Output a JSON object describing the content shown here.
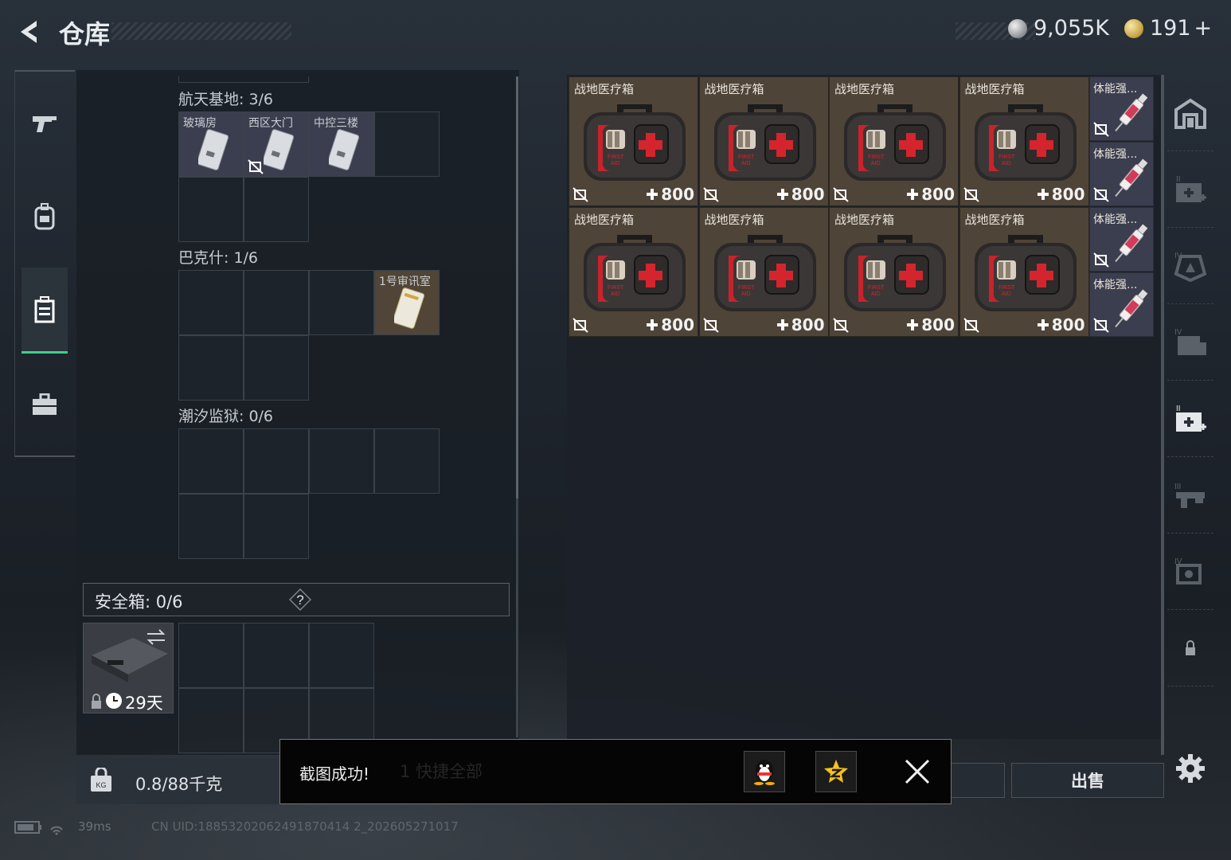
{
  "header": {
    "title": "仓库",
    "silver_amount": "9,055K",
    "gold_amount": "191",
    "gold_plus": "+"
  },
  "left": {
    "sections": [
      {
        "label": "航天基地: 3/6"
      },
      {
        "label": "巴克什: 1/6"
      },
      {
        "label": "潮汐监狱: 0/6"
      }
    ],
    "keycards": {
      "k1": "玻璃房",
      "k2": "西区大门",
      "k3": "中控三楼",
      "k4": "1号审讯室"
    },
    "safe_label": "安全箱:  0/6",
    "safe_help": "?",
    "safe_days": "29天",
    "weight": "0.8/88千克"
  },
  "items": {
    "medkit_name": "战地医疗箱",
    "medkit_value": "800",
    "syringe_name": "体能强..."
  },
  "toast": {
    "message": "截图成功!",
    "ghost_text": "1    快捷全部"
  },
  "actions": {
    "sell": "出售"
  },
  "status": {
    "ping": "39ms",
    "uid": "CN UID:18853202062491870414 2_202605271017"
  },
  "colors": {
    "accent_green": "#3bd08c",
    "item_bg": "#4f4438",
    "keycard_bg": "#3b3e4e"
  }
}
